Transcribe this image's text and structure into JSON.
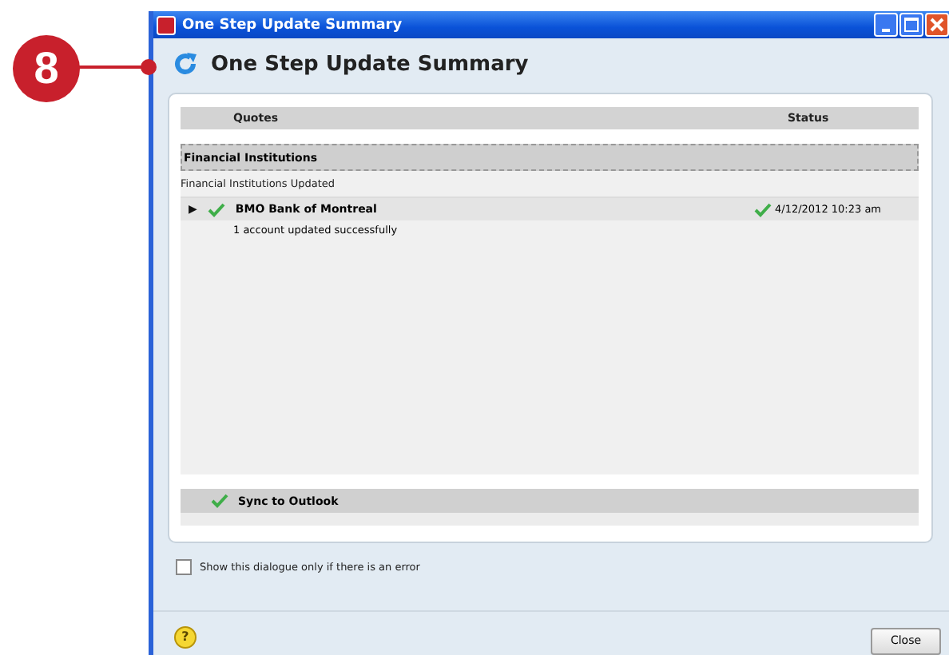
{
  "callout": {
    "number": "8"
  },
  "window": {
    "title": "One Step Update Summary",
    "heading": "One Step Update Summary"
  },
  "table": {
    "columns": [
      "Quotes",
      "Status"
    ],
    "groups": [
      {
        "name": "Financial Institutions",
        "subtitle": "Financial Institutions Updated",
        "rows": [
          {
            "expander": "▶",
            "expanded": false,
            "name": "BMO Bank of Montreal",
            "success": true,
            "status": "4/12/2012  10:23 am",
            "detail": "1 account updated successfully"
          }
        ]
      }
    ]
  },
  "sync": {
    "label": "Sync to Outlook",
    "success": true
  },
  "option": {
    "label": "Show this dialogue only if there is an error",
    "checked": false
  },
  "help": "?",
  "buttons": [
    "Close"
  ]
}
